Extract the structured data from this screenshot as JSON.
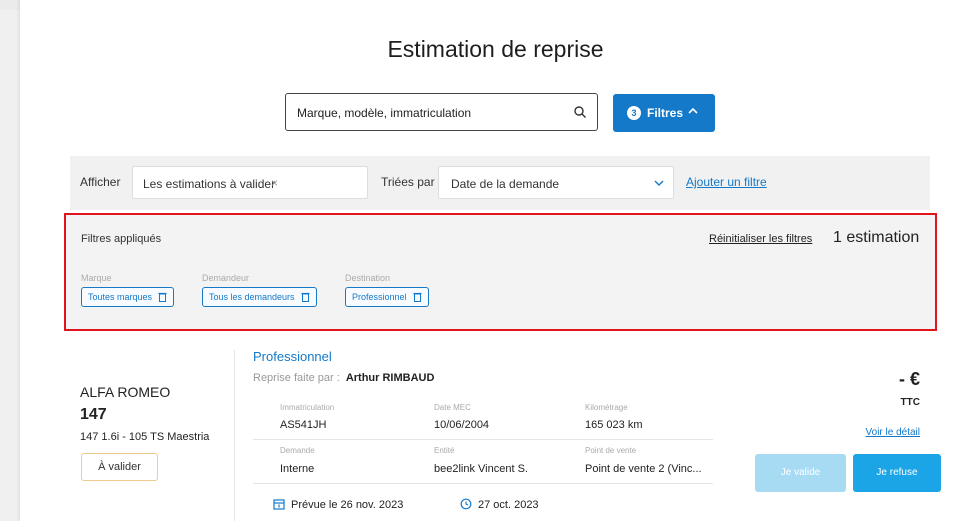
{
  "page": {
    "title": "Estimation de reprise"
  },
  "search": {
    "value": "Marque, modèle, immatriculation",
    "icon": "search-icon"
  },
  "filters_button": {
    "badge": "3",
    "label": "Filtres",
    "color": "#1479c8"
  },
  "filter_bar": {
    "show_label": "Afficher",
    "show_tag": "Les estimations à valider",
    "show_tag_remove": "×",
    "sort_label": "Triées par",
    "sort_value": "Date de la demande",
    "add_filter": "Ajouter un filtre"
  },
  "applied_filters": {
    "title": "Filtres appliqués",
    "reset": "Réinitialiser les filtres",
    "count": "1 estimation",
    "groups": [
      {
        "label": "Marque",
        "chip": "Toutes marques"
      },
      {
        "label": "Demandeur",
        "chip": "Tous les demandeurs"
      },
      {
        "label": "Destination",
        "chip": "Professionnel"
      }
    ],
    "highlight_color": "#e1141c"
  },
  "estimate": {
    "brand": "ALFA ROMEO",
    "model": "147",
    "version": "147 1.6i - 105 TS Maestria",
    "status": "À valider",
    "destination": "Professionnel",
    "reprise_label": "Reprise faite par :",
    "reprise_by": "Arthur RIMBAUD",
    "fields": {
      "immat_label": "Immatriculation",
      "immat_value": "AS541JH",
      "mec_label": "Date MEC",
      "mec_value": "10/06/2004",
      "km_label": "Kilométrage",
      "km_value": "165 023 km",
      "demande_label": "Demande",
      "demande_value": "Interne",
      "entite_label": "Entité",
      "entite_value": "bee2link Vincent S.",
      "pdv_label": "Point de vente",
      "pdv_value": "Point de vente 2 (Vinc..."
    },
    "planned_date": "Prévue le 26 nov. 2023",
    "created_date": "27 oct. 2023",
    "price": "- €",
    "ttc": "TTC",
    "detail_link": "Voir le détail",
    "validate_button": "Je valide",
    "refuse_button": "Je refuse"
  }
}
